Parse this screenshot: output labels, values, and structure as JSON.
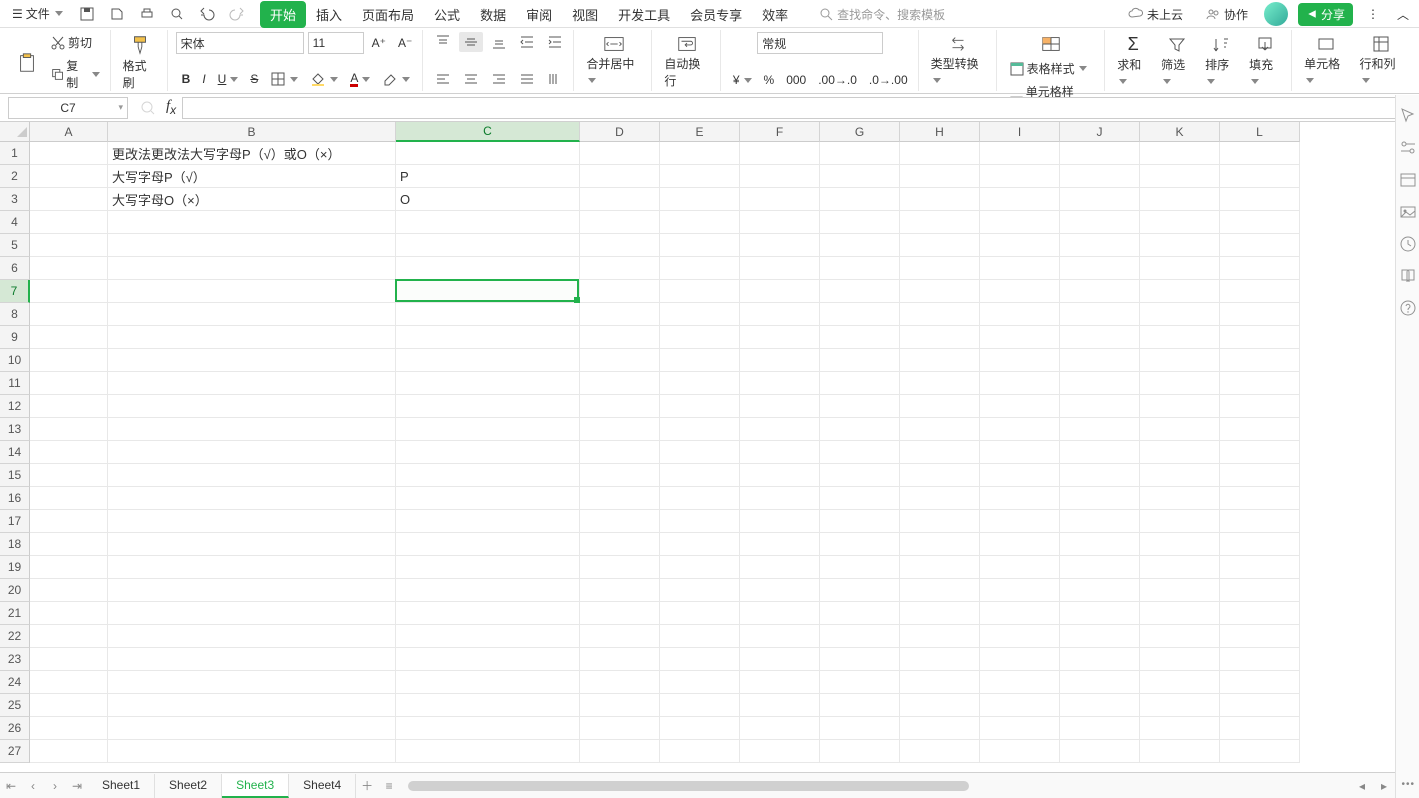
{
  "top": {
    "file": "文件",
    "notCloud": "未上云",
    "collab": "协作",
    "share": "分享"
  },
  "menu": [
    "开始",
    "插入",
    "页面布局",
    "公式",
    "数据",
    "审阅",
    "视图",
    "开发工具",
    "会员专享",
    "效率"
  ],
  "searchPlaceholder": "查找命令、搜索模板",
  "ribbon": {
    "paste": "粘贴",
    "cut": "剪切",
    "copy": "复制",
    "fmtPainter": "格式刷",
    "font": "宋体",
    "size": "11",
    "merge": "合并居中",
    "wrap": "自动换行",
    "numFmt": "常规",
    "typeConv": "类型转换",
    "condFmt": "条件格式",
    "tableStyle": "表格样式",
    "cellStyle": "单元格样式",
    "sum": "求和",
    "filter": "筛选",
    "sort": "排序",
    "fill": "填充",
    "cell": "单元格",
    "rowcol": "行和列"
  },
  "nameBox": "C7",
  "columns": [
    "A",
    "B",
    "C",
    "D",
    "E",
    "F",
    "G",
    "H",
    "I",
    "J",
    "K",
    "L"
  ],
  "rowsCount": 27,
  "selectedCell": {
    "col": "C",
    "row": 7
  },
  "cells": {
    "B1": "更改法更改法大写字母P（√）或O（×）",
    "B2": "大写字母P（√）",
    "C2": "P",
    "B3": "大写字母O（×）",
    "C3": "O"
  },
  "sheets": [
    "Sheet1",
    "Sheet2",
    "Sheet3",
    "Sheet4"
  ],
  "activeSheet": "Sheet3"
}
